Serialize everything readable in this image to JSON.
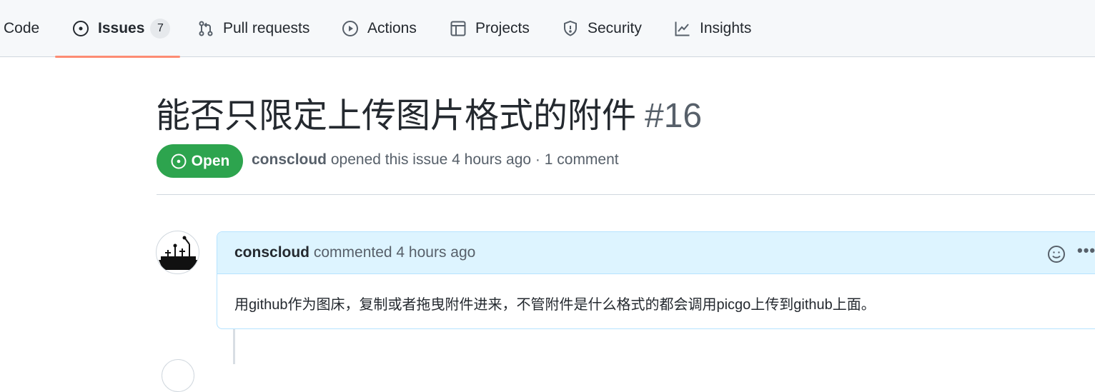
{
  "tabs": [
    {
      "label": "Code",
      "icon": "code-icon"
    },
    {
      "label": "Issues",
      "icon": "issue-opened-icon",
      "counter": "7",
      "active": true
    },
    {
      "label": "Pull requests",
      "icon": "git-pull-request-icon"
    },
    {
      "label": "Actions",
      "icon": "play-icon"
    },
    {
      "label": "Projects",
      "icon": "table-icon"
    },
    {
      "label": "Security",
      "icon": "shield-icon"
    },
    {
      "label": "Insights",
      "icon": "graph-icon"
    }
  ],
  "issue": {
    "title": "能否只限定上传图片格式的附件",
    "number": "#16",
    "state": "Open",
    "author": "conscloud",
    "opened_text": "opened this issue 4 hours ago",
    "separator": "·",
    "comment_count_text": "1 comment"
  },
  "comment": {
    "author": "conscloud",
    "action_text": "commented 4 hours ago",
    "body": "用github作为图床，复制或者拖曳附件进来，不管附件是什么格式的都会调用picgo上传到github上面。",
    "more_icon": "kebab-horizontal-icon",
    "react_icon": "smiley-icon"
  },
  "colors": {
    "accent_underline": "#fd8c73",
    "open_green": "#2da44e",
    "comment_header_bg": "#ddf4ff"
  }
}
